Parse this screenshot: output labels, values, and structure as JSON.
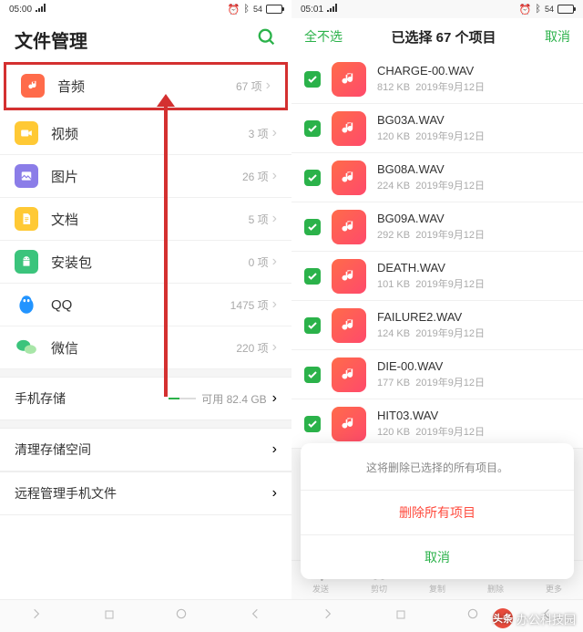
{
  "left": {
    "status": {
      "time": "05:00",
      "battery": "54"
    },
    "title": "文件管理",
    "rows": [
      {
        "label": "音频",
        "count": "67 项",
        "icon": "audio"
      },
      {
        "label": "视频",
        "count": "3 项",
        "icon": "video"
      },
      {
        "label": "图片",
        "count": "26 项",
        "icon": "image"
      },
      {
        "label": "文档",
        "count": "5 项",
        "icon": "doc"
      },
      {
        "label": "安装包",
        "count": "0 项",
        "icon": "apk"
      },
      {
        "label": "QQ",
        "count": "1475 项",
        "icon": "qq"
      },
      {
        "label": "微信",
        "count": "220 项",
        "icon": "wechat"
      }
    ],
    "storage": {
      "label": "手机存储",
      "free": "可用 82.4 GB"
    },
    "clean": "清理存储空间",
    "remote": "远程管理手机文件"
  },
  "right": {
    "status": {
      "time": "05:01",
      "battery": "54"
    },
    "header": {
      "deselect": "全不选",
      "title": "已选择 67 个项目",
      "cancel": "取消"
    },
    "files": [
      {
        "name": "CHARGE-00.WAV",
        "size": "812 KB",
        "date": "2019年9月12日"
      },
      {
        "name": "BG03A.WAV",
        "size": "120 KB",
        "date": "2019年9月12日"
      },
      {
        "name": "BG08A.WAV",
        "size": "224 KB",
        "date": "2019年9月12日"
      },
      {
        "name": "BG09A.WAV",
        "size": "292 KB",
        "date": "2019年9月12日"
      },
      {
        "name": "DEATH.WAV",
        "size": "101 KB",
        "date": "2019年9月12日"
      },
      {
        "name": "FAILURE2.WAV",
        "size": "124 KB",
        "date": "2019年9月12日"
      },
      {
        "name": "DIE-00.WAV",
        "size": "177 KB",
        "date": "2019年9月12日"
      },
      {
        "name": "HIT03.WAV",
        "size": "120 KB",
        "date": "2019年9月12日"
      }
    ],
    "dialog": {
      "head": "这将删除已选择的所有项目。",
      "delete": "删除所有项目",
      "cancel": "取消"
    },
    "toolbar": [
      "发送",
      "剪切",
      "复制",
      "删除",
      "更多"
    ]
  },
  "watermark": "办公科技园"
}
